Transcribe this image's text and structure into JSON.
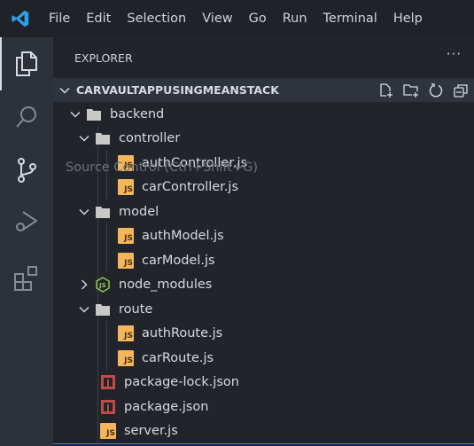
{
  "menu": [
    "File",
    "Edit",
    "Selection",
    "View",
    "Go",
    "Run",
    "Terminal",
    "Help"
  ],
  "activity": [
    "explorer",
    "search",
    "source-control",
    "run-and-debug",
    "extensions"
  ],
  "tooltip": "Source Control (Ctrl+Shift+G)",
  "explorer": {
    "title": "EXPLORER",
    "more": "···",
    "root": "CARVAULTAPPUSINGMEANSTACK"
  },
  "tree": [
    {
      "label": "backend",
      "type": "folder",
      "depth": 0,
      "expanded": true
    },
    {
      "label": "controller",
      "type": "folder",
      "depth": 1,
      "expanded": true
    },
    {
      "label": "authController.js",
      "type": "js",
      "depth": 2
    },
    {
      "label": "carController.js",
      "type": "js",
      "depth": 2
    },
    {
      "label": "model",
      "type": "folder",
      "depth": 1,
      "expanded": true
    },
    {
      "label": "authModel.js",
      "type": "js",
      "depth": 2
    },
    {
      "label": "carModel.js",
      "type": "js",
      "depth": 2
    },
    {
      "label": "node_modules",
      "type": "node",
      "depth": 1,
      "expanded": false
    },
    {
      "label": "route",
      "type": "folder",
      "depth": 1,
      "expanded": true
    },
    {
      "label": "authRoute.js",
      "type": "js",
      "depth": 2
    },
    {
      "label": "carRoute.js",
      "type": "js",
      "depth": 2
    },
    {
      "label": "package-lock.json",
      "type": "npm",
      "depth": 1
    },
    {
      "label": "package.json",
      "type": "npm",
      "depth": 1
    },
    {
      "label": "server.js",
      "type": "js",
      "depth": 1
    }
  ],
  "colors": {
    "accent": "#3c7bd6",
    "js": "#f3b65c",
    "npm": "#c04a48",
    "node": "#8cc84b"
  }
}
